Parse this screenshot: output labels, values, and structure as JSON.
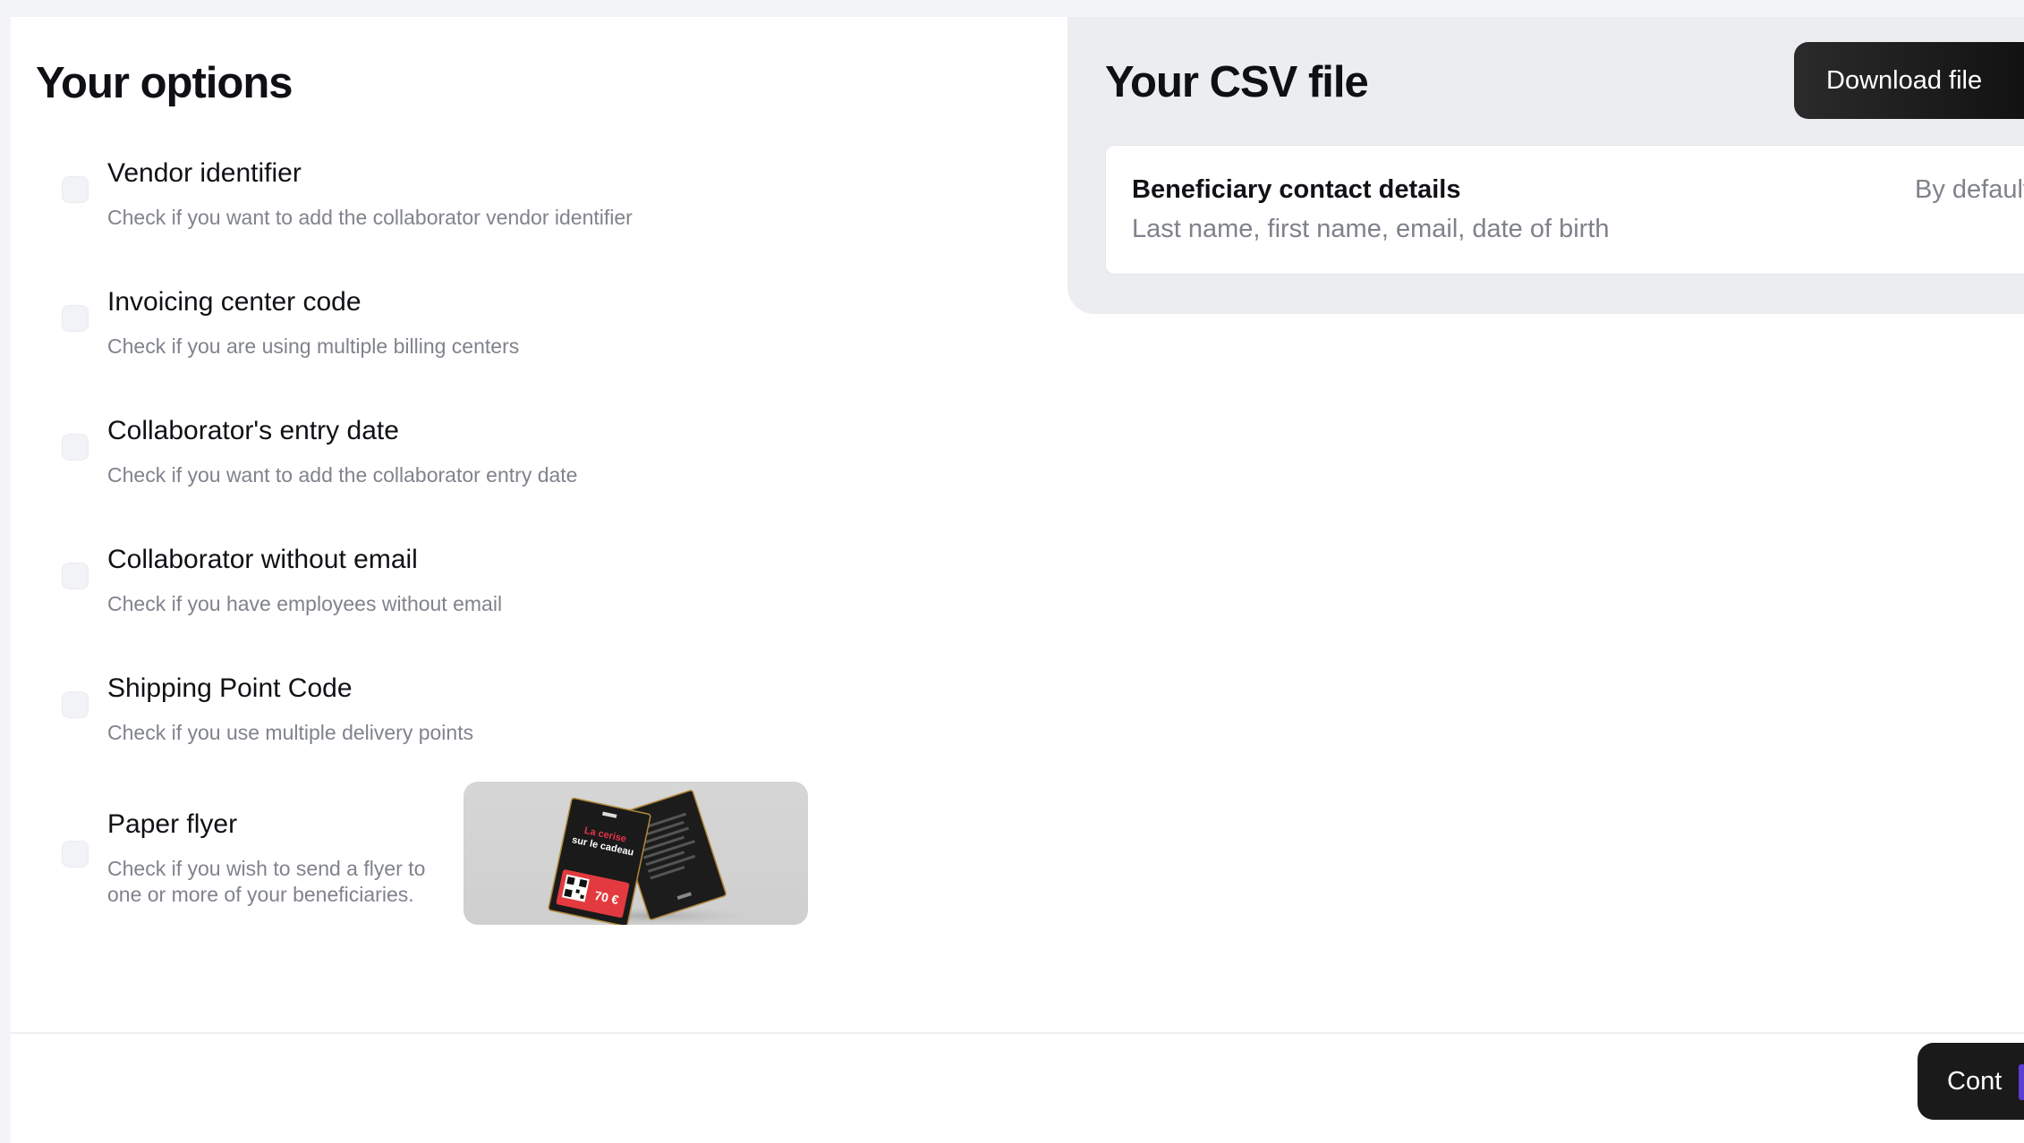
{
  "options": {
    "title": "Your options",
    "items": [
      {
        "title": "Vendor identifier",
        "description": "Check if you want to add the collaborator vendor identifier",
        "checked": false
      },
      {
        "title": "Invoicing center code",
        "description": "Check if you are using multiple billing centers",
        "checked": false
      },
      {
        "title": "Collaborator's entry date",
        "description": "Check if you want to add the collaborator entry date",
        "checked": false
      },
      {
        "title": "Collaborator without email",
        "description": "Check if you have employees without email",
        "checked": false
      },
      {
        "title": "Shipping Point Code",
        "description": "Check if you use multiple delivery points",
        "checked": false
      },
      {
        "title": "Paper flyer",
        "description": "Check if you wish to send a flyer to one or more of your beneficiaries.",
        "checked": false
      }
    ],
    "flyer_image": {
      "front_line1": "La cerise",
      "front_line2": "sur le cadeau",
      "amount": "70 €"
    }
  },
  "csv": {
    "title": "Your CSV file",
    "download_label": "Download file",
    "card": {
      "title": "Beneficiary contact details",
      "description": "Last name, first name, email, date of birth",
      "tag": "By default"
    }
  },
  "footer": {
    "continue_label": "Cont"
  },
  "colors": {
    "background": "#f3f4f7",
    "panel": "#ecedf1",
    "button_dark": "#1a1a1a",
    "muted_text": "#80838c",
    "accent_edge": "#5b3fd6"
  }
}
